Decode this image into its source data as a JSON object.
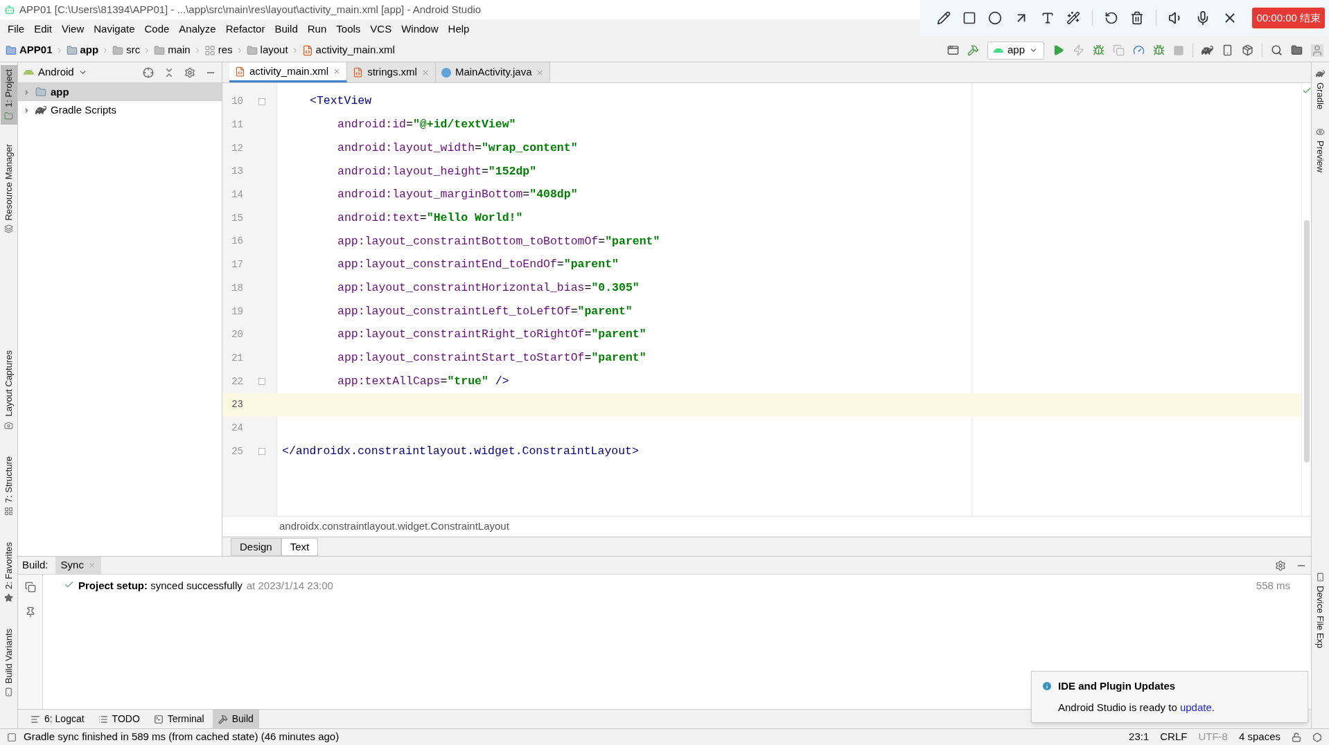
{
  "title_bar": {
    "title": "APP01 [C:\\Users\\81394\\APP01] - ...\\app\\src\\main\\res\\layout\\activity_main.xml [app] - Android Studio"
  },
  "recorder": {
    "timer": "00:00:00 结束"
  },
  "menu": [
    "File",
    "Edit",
    "View",
    "Navigate",
    "Code",
    "Analyze",
    "Refactor",
    "Build",
    "Run",
    "Tools",
    "VCS",
    "Window",
    "Help"
  ],
  "breadcrumbs": [
    {
      "label": "APP01",
      "kind": "project"
    },
    {
      "label": "app",
      "kind": "module"
    },
    {
      "label": "src",
      "kind": "folder"
    },
    {
      "label": "main",
      "kind": "folder"
    },
    {
      "label": "res",
      "kind": "resources"
    },
    {
      "label": "layout",
      "kind": "folder"
    },
    {
      "label": "activity_main.xml",
      "kind": "file"
    }
  ],
  "run_config": {
    "label": "app"
  },
  "left_tool_windows": {
    "top": [
      {
        "label": "1: Project",
        "selected": true,
        "kind": "project"
      },
      {
        "label": "Resource Manager",
        "selected": false,
        "kind": "resources"
      }
    ],
    "bottom": [
      {
        "label": "Layout Captures",
        "selected": false,
        "kind": "captures"
      },
      {
        "label": "7: Structure",
        "selected": false,
        "kind": "structure"
      },
      {
        "label": "2: Favorites",
        "selected": false,
        "kind": "favorites"
      },
      {
        "label": "Build Variants",
        "selected": false,
        "kind": "variants"
      }
    ]
  },
  "project_panel": {
    "view": "Android",
    "tree": [
      {
        "label": "app",
        "selected": true,
        "expanded": false,
        "kind": "module"
      },
      {
        "label": "Gradle Scripts",
        "selected": false,
        "expanded": false,
        "kind": "gradle"
      }
    ]
  },
  "editor_tabs": [
    {
      "label": "activity_main.xml",
      "selected": true,
      "kind": "xml"
    },
    {
      "label": "strings.xml",
      "selected": false,
      "kind": "xml"
    },
    {
      "label": "MainActivity.java",
      "selected": false,
      "kind": "java"
    }
  ],
  "code_lines": [
    {
      "number": "10",
      "kind": "open_tag",
      "current": false,
      "folding": true,
      "segments": [
        {
          "kind": "tag",
          "text": "<TextView"
        }
      ]
    },
    {
      "number": "11",
      "kind": "attribute",
      "current": false,
      "folding": false,
      "segments": [
        {
          "kind": "attr",
          "text": "android:id"
        },
        {
          "kind": "plain",
          "text": "="
        },
        {
          "kind": "value",
          "text": "\"@+id/textView\""
        }
      ]
    },
    {
      "number": "12",
      "kind": "attribute",
      "current": false,
      "folding": false,
      "segments": [
        {
          "kind": "attr",
          "text": "android:layout_width"
        },
        {
          "kind": "plain",
          "text": "="
        },
        {
          "kind": "value",
          "text": "\"wrap_content\""
        }
      ]
    },
    {
      "number": "13",
      "kind": "attribute",
      "current": false,
      "folding": false,
      "segments": [
        {
          "kind": "attr",
          "text": "android:layout_height"
        },
        {
          "kind": "plain",
          "text": "="
        },
        {
          "kind": "value",
          "text": "\"152dp\""
        }
      ]
    },
    {
      "number": "14",
      "kind": "attribute",
      "current": false,
      "folding": false,
      "segments": [
        {
          "kind": "attr",
          "text": "android:layout_marginBottom"
        },
        {
          "kind": "plain",
          "text": "="
        },
        {
          "kind": "value",
          "text": "\"408dp\""
        }
      ]
    },
    {
      "number": "15",
      "kind": "attribute",
      "current": false,
      "folding": false,
      "segments": [
        {
          "kind": "attr",
          "text": "android:text"
        },
        {
          "kind": "plain",
          "text": "="
        },
        {
          "kind": "value",
          "text": "\"Hello World!\""
        }
      ]
    },
    {
      "number": "16",
      "kind": "attribute",
      "current": false,
      "folding": false,
      "segments": [
        {
          "kind": "attr",
          "text": "app:layout_constraintBottom_toBottomOf"
        },
        {
          "kind": "plain",
          "text": "="
        },
        {
          "kind": "value",
          "text": "\"parent\""
        }
      ]
    },
    {
      "number": "17",
      "kind": "attribute",
      "current": false,
      "folding": false,
      "segments": [
        {
          "kind": "attr",
          "text": "app:layout_constraintEnd_toEndOf"
        },
        {
          "kind": "plain",
          "text": "="
        },
        {
          "kind": "value",
          "text": "\"parent\""
        }
      ]
    },
    {
      "number": "18",
      "kind": "attribute",
      "current": false,
      "folding": false,
      "segments": [
        {
          "kind": "attr",
          "text": "app:layout_constraintHorizontal_bias"
        },
        {
          "kind": "plain",
          "text": "="
        },
        {
          "kind": "value",
          "text": "\"0.305\""
        }
      ]
    },
    {
      "number": "19",
      "kind": "attribute",
      "current": false,
      "folding": false,
      "segments": [
        {
          "kind": "attr",
          "text": "app:layout_constraintLeft_toLeftOf"
        },
        {
          "kind": "plain",
          "text": "="
        },
        {
          "kind": "value",
          "text": "\"parent\""
        }
      ]
    },
    {
      "number": "20",
      "kind": "attribute",
      "current": false,
      "folding": false,
      "segments": [
        {
          "kind": "attr",
          "text": "app:layout_constraintRight_toRightOf"
        },
        {
          "kind": "plain",
          "text": "="
        },
        {
          "kind": "value",
          "text": "\"parent\""
        }
      ]
    },
    {
      "number": "21",
      "kind": "attribute",
      "current": false,
      "folding": false,
      "segments": [
        {
          "kind": "attr",
          "text": "app:layout_constraintStart_toStartOf"
        },
        {
          "kind": "plain",
          "text": "="
        },
        {
          "kind": "value",
          "text": "\"parent\""
        }
      ]
    },
    {
      "number": "22",
      "kind": "attribute",
      "current": false,
      "folding": true,
      "segments": [
        {
          "kind": "attr",
          "text": "app:textAllCaps"
        },
        {
          "kind": "plain",
          "text": "="
        },
        {
          "kind": "value",
          "text": "\"true\""
        },
        {
          "kind": "tag",
          "text": " />"
        }
      ]
    },
    {
      "number": "23",
      "kind": "blank",
      "current": true,
      "folding": false
    },
    {
      "number": "24",
      "kind": "blank",
      "current": false,
      "folding": false
    },
    {
      "number": "25",
      "kind": "close_tag",
      "current": false,
      "folding": true,
      "segments": [
        {
          "kind": "tag",
          "text": "</androidx.constraintlayout.widget.ConstraintLayout>"
        }
      ]
    }
  ],
  "editor_breadcrumb": "androidx.constraintlayout.widget.ConstraintLayout",
  "view_tabs": [
    {
      "label": "Design",
      "selected": false
    },
    {
      "label": "Text",
      "selected": true
    }
  ],
  "build_panel": {
    "title": "Build:",
    "tabs": [
      {
        "label": "Sync",
        "selected": true
      }
    ],
    "message": {
      "text": "**Project setup:** synced successfully",
      "time": "at 2023/1/14 23:00",
      "duration": "558 ms"
    }
  },
  "bottom_tool_tabs": [
    {
      "label": "6: Logcat",
      "selected": false,
      "kind": "logcat"
    },
    {
      "label": "TODO",
      "selected": false,
      "kind": "todo"
    },
    {
      "label": "Terminal",
      "selected": false,
      "kind": "terminal"
    },
    {
      "label": "Build",
      "selected": true,
      "kind": "build"
    }
  ],
  "right_tool_windows": {
    "top": [
      {
        "label": "Gradle",
        "kind": "gradle"
      },
      {
        "label": "Preview",
        "kind": "preview"
      }
    ],
    "bottom": [
      {
        "label": "Device File Exp",
        "kind": "device"
      }
    ]
  },
  "notification": {
    "title": "IDE and Plugin Updates",
    "text_before": "Android Studio is ready to ",
    "link": "update",
    "text_after": "."
  },
  "status_bar": {
    "message": "Gradle sync finished in 589 ms (from cached state) (46 minutes ago)",
    "position": "23:1",
    "line_separator": "CRLF",
    "encoding": "UTF-8",
    "indent": "4 spaces"
  }
}
